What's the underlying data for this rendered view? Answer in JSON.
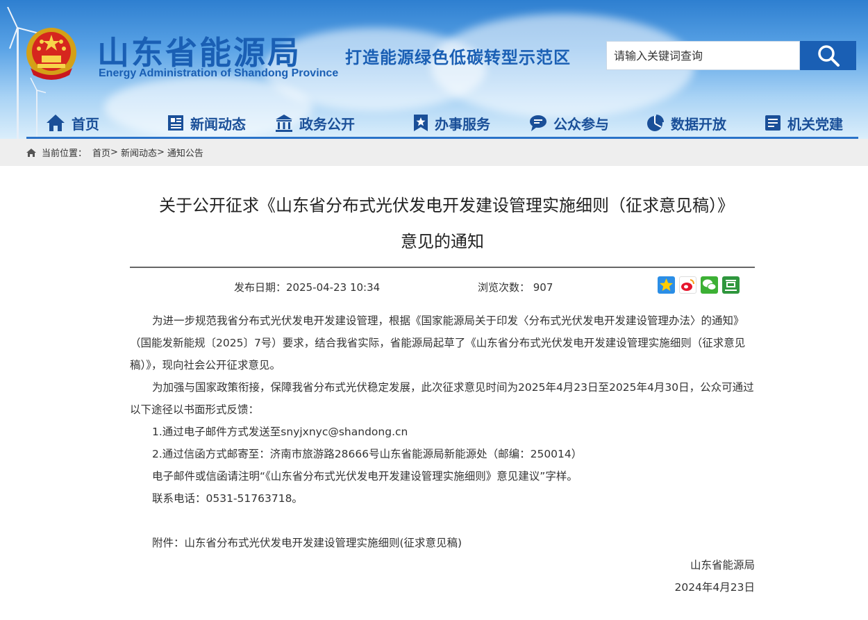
{
  "header": {
    "title": "山东省能源局",
    "subtitle": "Energy Administration of Shandong Province",
    "slogan": "打造能源绿色低碳转型示范区",
    "search_placeholder": "请输入关键词查询"
  },
  "nav": {
    "items": [
      {
        "label": "首页",
        "icon": "home-icon"
      },
      {
        "label": "新闻动态",
        "icon": "news-icon"
      },
      {
        "label": "政务公开",
        "icon": "government-icon"
      },
      {
        "label": "办事服务",
        "icon": "service-icon"
      },
      {
        "label": "公众参与",
        "icon": "chat-icon"
      },
      {
        "label": "数据开放",
        "icon": "pie-chart-icon"
      },
      {
        "label": "机关党建",
        "icon": "party-icon"
      }
    ]
  },
  "breadcrumb": {
    "prefix": "当前位置：",
    "items": [
      "首页",
      "新闻动态",
      "通知公告"
    ],
    "separator": ">"
  },
  "article": {
    "title": "关于公开征求《山东省分布式光伏发电开发建设管理实施细则（征求意见稿）》意见的通知",
    "date": "发布日期：2025-04-23 10:34",
    "views": "浏览次数： 907",
    "share_icons": [
      "qzone-icon",
      "weibo-icon",
      "wechat-icon",
      "douban-icon"
    ],
    "paragraphs": [
      "为进一步规范我省分布式光伏发电开发建设管理，根据《国家能源局关于印发〈分布式光伏发电开发建设管理办法〉的通知》（国能发新能规〔2025〕7号）要求，结合我省实际，省能源局起草了《山东省分布式光伏发电开发建设管理实施细则（征求意见稿）》，现向社会公开征求意见。",
      "为加强与国家政策衔接，保障我省分布式光伏稳定发展，此次征求意见时间为2025年4月23日至2025年4月30日，公众可通过以下途径以书面形式反馈：",
      "1.通过电子邮件方式发送至snyjxnyc@shandong.cn",
      "2.通过信函方式邮寄至：济南市旅游路28666号山东省能源局新能源处（邮编：250014）",
      "电子邮件或信函请注明“《山东省分布式光伏发电开发建设管理实施细则》意见建议”字样。",
      "联系电话：0531-51763718。"
    ],
    "attachment": "附件：山东省分布式光伏发电开发建设管理实施细则(征求意见稿)",
    "signature": "山东省能源局",
    "sign_date": "2024年4月23日"
  },
  "colors": {
    "brand": "#1a5fb4",
    "nav_text": "#1a4f98",
    "breadcrumb_bg": "#eeeeee"
  }
}
